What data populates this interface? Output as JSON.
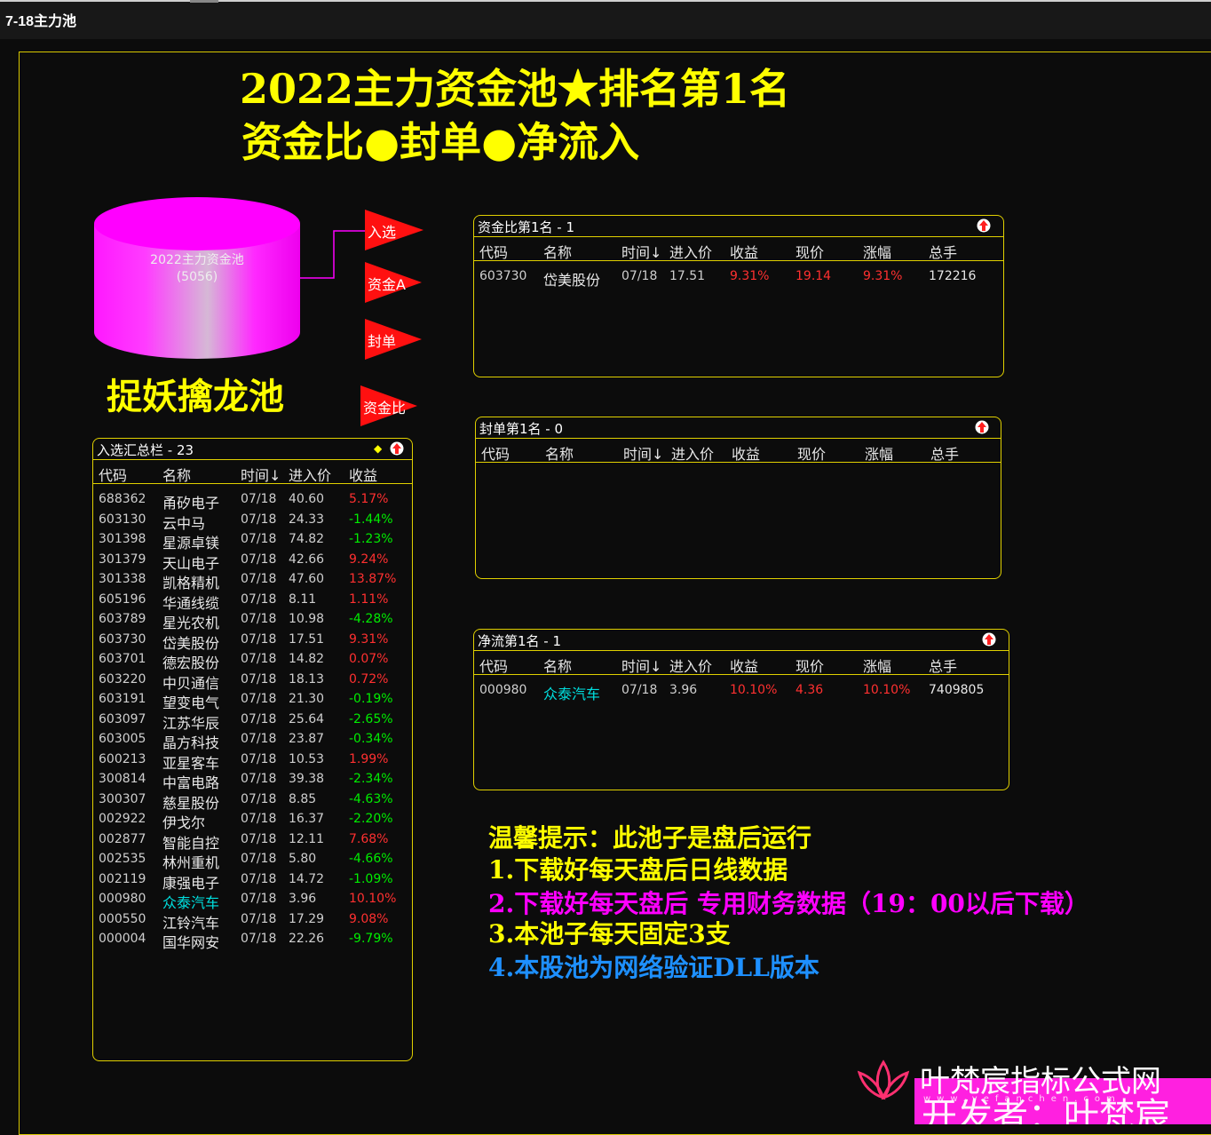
{
  "window": {
    "title": "7-18主力池"
  },
  "heading": {
    "line1": "2022主力资金池★排名第1名",
    "line2": "资金比●封单●净流入"
  },
  "pool": {
    "cylinder_line1": "2022主力资金池",
    "cylinder_line2": "(5056)",
    "title": "捉妖擒龙池"
  },
  "flags": [
    "入选",
    "资金A",
    "封单",
    "资金比"
  ],
  "colors": {
    "accent": "#ffff00",
    "up": "#ff3030",
    "down": "#00ee00",
    "magenta": "#ff00ff"
  },
  "summary_panel": {
    "title": "入选汇总栏 - 23",
    "columns": [
      "代码",
      "名称",
      "时间↓",
      "进入价",
      "收益"
    ],
    "rows": [
      {
        "code": "688362",
        "name": "甬矽电子",
        "time": "07/18",
        "price": "40.60",
        "gain": "5.17%",
        "dir": "up"
      },
      {
        "code": "603130",
        "name": "云中马",
        "time": "07/18",
        "price": "24.33",
        "gain": "-1.44%",
        "dir": "down"
      },
      {
        "code": "301398",
        "name": "星源卓镁",
        "time": "07/18",
        "price": "74.82",
        "gain": "-1.23%",
        "dir": "down"
      },
      {
        "code": "301379",
        "name": "天山电子",
        "time": "07/18",
        "price": "42.66",
        "gain": "9.24%",
        "dir": "up"
      },
      {
        "code": "301338",
        "name": "凯格精机",
        "time": "07/18",
        "price": "47.60",
        "gain": "13.87%",
        "dir": "up"
      },
      {
        "code": "605196",
        "name": "华通线缆",
        "time": "07/18",
        "price": "8.11",
        "gain": "1.11%",
        "dir": "up"
      },
      {
        "code": "603789",
        "name": "星光农机",
        "time": "07/18",
        "price": "10.98",
        "gain": "-4.28%",
        "dir": "down"
      },
      {
        "code": "603730",
        "name": "岱美股份",
        "time": "07/18",
        "price": "17.51",
        "gain": "9.31%",
        "dir": "up"
      },
      {
        "code": "603701",
        "name": "德宏股份",
        "time": "07/18",
        "price": "14.82",
        "gain": "0.07%",
        "dir": "up"
      },
      {
        "code": "603220",
        "name": "中贝通信",
        "time": "07/18",
        "price": "18.13",
        "gain": "0.72%",
        "dir": "up"
      },
      {
        "code": "603191",
        "name": "望变电气",
        "time": "07/18",
        "price": "21.30",
        "gain": "-0.19%",
        "dir": "down"
      },
      {
        "code": "603097",
        "name": "江苏华辰",
        "time": "07/18",
        "price": "25.64",
        "gain": "-2.65%",
        "dir": "down"
      },
      {
        "code": "603005",
        "name": "晶方科技",
        "time": "07/18",
        "price": "23.87",
        "gain": "-0.34%",
        "dir": "down"
      },
      {
        "code": "600213",
        "name": "亚星客车",
        "time": "07/18",
        "price": "10.53",
        "gain": "1.99%",
        "dir": "up"
      },
      {
        "code": "300814",
        "name": "中富电路",
        "time": "07/18",
        "price": "39.38",
        "gain": "-2.34%",
        "dir": "down"
      },
      {
        "code": "300307",
        "name": "慈星股份",
        "time": "07/18",
        "price": "8.85",
        "gain": "-4.63%",
        "dir": "down"
      },
      {
        "code": "002922",
        "name": "伊戈尔",
        "time": "07/18",
        "price": "16.37",
        "gain": "-2.20%",
        "dir": "down"
      },
      {
        "code": "002877",
        "name": "智能自控",
        "time": "07/18",
        "price": "12.11",
        "gain": "7.68%",
        "dir": "up"
      },
      {
        "code": "002535",
        "name": "林州重机",
        "time": "07/18",
        "price": "5.80",
        "gain": "-4.66%",
        "dir": "down"
      },
      {
        "code": "002119",
        "name": "康强电子",
        "time": "07/18",
        "price": "14.72",
        "gain": "-1.09%",
        "dir": "down"
      },
      {
        "code": "000980",
        "name": "众泰汽车",
        "time": "07/18",
        "price": "3.96",
        "gain": "10.10%",
        "dir": "up",
        "highlight": true
      },
      {
        "code": "000550",
        "name": "江铃汽车",
        "time": "07/18",
        "price": "17.29",
        "gain": "9.08%",
        "dir": "up"
      },
      {
        "code": "000004",
        "name": "国华网安",
        "time": "07/18",
        "price": "22.26",
        "gain": "-9.79%",
        "dir": "down"
      }
    ]
  },
  "rank_panels": [
    {
      "title": "资金比第1名 - 1",
      "columns": [
        "代码",
        "名称",
        "时间↓",
        "进入价",
        "收益",
        "现价",
        "涨幅",
        "总手"
      ],
      "rows": [
        {
          "code": "603730",
          "name": "岱美股份",
          "time": "07/18",
          "price": "17.51",
          "gain": "9.31%",
          "now": "19.14",
          "change": "9.31%",
          "volume": "172216",
          "highlight": false
        }
      ]
    },
    {
      "title": "封单第1名 - 0",
      "columns": [
        "代码",
        "名称",
        "时间↓",
        "进入价",
        "收益",
        "现价",
        "涨幅",
        "总手"
      ],
      "rows": []
    },
    {
      "title": "净流第1名 - 1",
      "columns": [
        "代码",
        "名称",
        "时间↓",
        "进入价",
        "收益",
        "现价",
        "涨幅",
        "总手"
      ],
      "rows": [
        {
          "code": "000980",
          "name": "众泰汽车",
          "time": "07/18",
          "price": "3.96",
          "gain": "10.10%",
          "now": "4.36",
          "change": "10.10%",
          "volume": "7409805",
          "highlight": true
        }
      ]
    }
  ],
  "notice": {
    "line0": "温馨提示：此池子是盘后运行",
    "line1": "1.下载好每天盘后日线数据",
    "line2": "2.下载好每天盘后 专用财务数据（19：00以后下载）",
    "line3": "3.本池子每天固定3支",
    "line4": "4.本股池为网络验证DLL版本"
  },
  "watermark": {
    "site": "叶梵宸指标公式网",
    "author": "开发者：叶梵宸",
    "url": "www.yefanchen.com"
  }
}
